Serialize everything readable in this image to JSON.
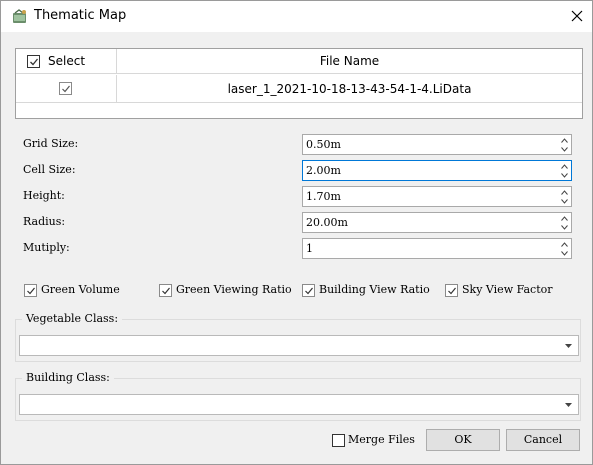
{
  "window": {
    "title": "Thematic Map"
  },
  "table": {
    "select_header": "Select",
    "filename_header": "File Name",
    "rows": [
      {
        "checked": true,
        "file_name": "laser_1_2021-10-18-13-43-54-1-4.LiData"
      }
    ]
  },
  "fields": {
    "grid_size": {
      "label": "Grid Size:",
      "value": "0.50m"
    },
    "cell_size": {
      "label": "Cell Size:",
      "value": "2.00m"
    },
    "height": {
      "label": "Height:",
      "value": "1.70m"
    },
    "radius": {
      "label": "Radius:",
      "value": "20.00m"
    },
    "multiply": {
      "label": "Mutiply:",
      "value": "1"
    }
  },
  "options": {
    "green_volume": {
      "label": "Green Volume",
      "checked": true
    },
    "green_viewing_ratio": {
      "label": "Green Viewing Ratio",
      "checked": true
    },
    "building_view_ratio": {
      "label": "Building View Ratio",
      "checked": true
    },
    "sky_view_factor": {
      "label": "Sky View Factor",
      "checked": true
    }
  },
  "vegetable_class": {
    "title": "Vegetable Class:",
    "value": ""
  },
  "building_class": {
    "title": "Building Class:",
    "value": ""
  },
  "footer": {
    "merge_files": {
      "label": "Merge Files",
      "checked": false
    },
    "ok_label": "OK",
    "cancel_label": "Cancel"
  },
  "icons": {
    "app": "thematic-map-app-icon",
    "close": "close-icon",
    "check": "checkmark-icon",
    "spin_up": "spin-up-arrow-icon",
    "spin_down": "spin-down-arrow-icon",
    "dropdown": "dropdown-arrow-icon"
  },
  "colors": {
    "focus_border": "#0078d7"
  }
}
